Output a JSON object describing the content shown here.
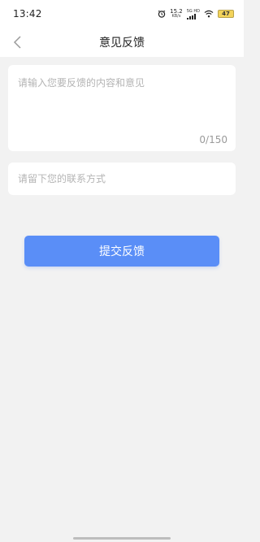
{
  "status_bar": {
    "time": "13:42",
    "net_speed_value": "15.2",
    "net_speed_unit": "KB/s",
    "network_type": "5G HD",
    "battery": "47",
    "icons": [
      "alarm-icon",
      "signal-icon",
      "wifi-icon",
      "battery-icon"
    ]
  },
  "nav": {
    "back_icon": "chevron-left-icon",
    "title": "意见反馈"
  },
  "feedback": {
    "placeholder": "请输入您要反馈的内容和意见",
    "value": "",
    "counter": "0/150"
  },
  "contact": {
    "placeholder": "请留下您的联系方式",
    "value": ""
  },
  "submit": {
    "label": "提交反馈"
  },
  "colors": {
    "accent": "#5a8ef7",
    "background": "#f2f2f2",
    "card": "#ffffff",
    "placeholder": "#b4b4b4",
    "battery": "#f3d35b"
  }
}
